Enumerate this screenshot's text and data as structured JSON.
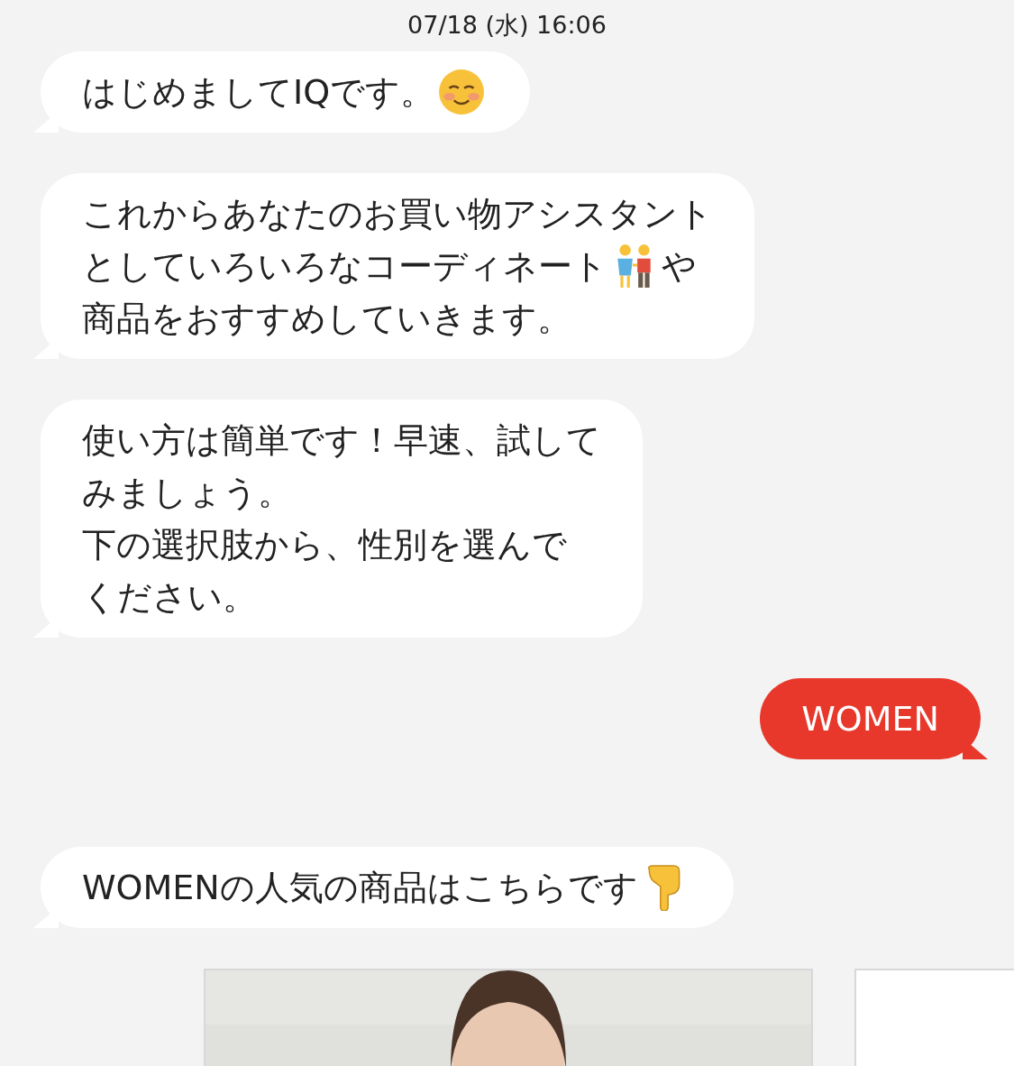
{
  "timestamp": "07/18 (水) 16:06",
  "messages": [
    {
      "kind": "left",
      "lines": [
        [
          {
            "kind": "text",
            "text": "はじめましてIQです。"
          },
          {
            "kind": "smile"
          }
        ]
      ]
    },
    {
      "kind": "left",
      "lines": [
        [
          {
            "kind": "text",
            "text": "これからあなたのお買い物アシスタント"
          }
        ],
        [
          {
            "kind": "text",
            "text": "としていろいろなコーディネート"
          },
          {
            "kind": "couple"
          },
          {
            "kind": "text",
            "text": "や"
          }
        ],
        [
          {
            "kind": "text",
            "text": "商品をおすすめしていきます。"
          }
        ]
      ]
    },
    {
      "kind": "left",
      "lines": [
        [
          {
            "kind": "text",
            "text": "使い方は簡単です！早速、試して"
          }
        ],
        [
          {
            "kind": "text",
            "text": "みましょう。"
          }
        ],
        [
          {
            "kind": "text",
            "text": "下の選択肢から、性別を選んで"
          }
        ],
        [
          {
            "kind": "text",
            "text": "ください。"
          }
        ]
      ]
    },
    {
      "kind": "right",
      "lines": [
        [
          {
            "kind": "text",
            "text": "WOMEN"
          }
        ]
      ]
    },
    {
      "kind": "left",
      "lines": [
        [
          {
            "kind": "text",
            "text": "WOMENの人気の商品はこちらです"
          },
          {
            "kind": "pointer"
          }
        ]
      ]
    }
  ],
  "products": [
    {
      "kind": "picture"
    },
    {
      "kind": "blank"
    }
  ]
}
